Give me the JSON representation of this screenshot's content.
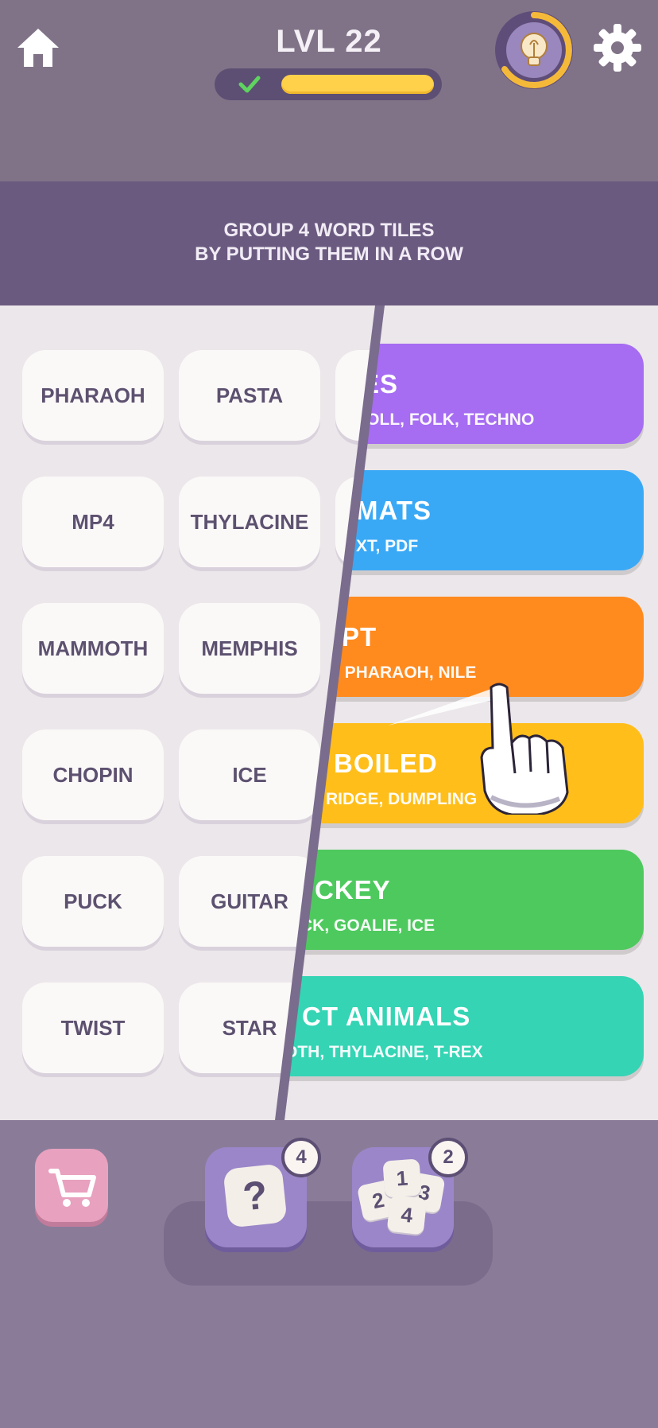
{
  "header": {
    "level_label": "LVL 22",
    "progress": 0.92
  },
  "instructions": {
    "line1": "GROUP 4 WORD TILES",
    "line2": "BY PUTTING THEM IN A ROW"
  },
  "tiles": [
    [
      "PHARAOH",
      "PASTA"
    ],
    [
      "MP4",
      "THYLACINE"
    ],
    [
      "MAMMOTH",
      "MEMPHIS"
    ],
    [
      "CHOPIN",
      "ICE"
    ],
    [
      "PUCK",
      "GUITAR"
    ],
    [
      "TWIST",
      "STAR"
    ]
  ],
  "categories": [
    {
      "name": "IRES",
      "words": "N' ROLL, FOLK, TECHNO",
      "color": "#a66cf2"
    },
    {
      "name": "MATS",
      "words": "XT, PDF",
      "color": "#3aa9f5"
    },
    {
      "name": "PT",
      "words": "S, PHARAOH, NILE",
      "color": "#ff8a1e"
    },
    {
      "name": "BOILED",
      "words": "RIDGE, DUMPLING",
      "color": "#ffbe1a"
    },
    {
      "name": "CKEY",
      "words": "CK, GOALIE, ICE",
      "color": "#4ec95e"
    },
    {
      "name": "CT ANIMALS",
      "words": "OTH, THYLACINE, T-REX",
      "color": "#34d4b4"
    }
  ],
  "boosters": {
    "hint_count": "4",
    "shuffle_count": "2",
    "shuffle_numbers": [
      "1",
      "2",
      "3",
      "4"
    ],
    "hint_symbol": "?"
  },
  "icons": [
    "home-icon",
    "check-icon",
    "lightbulb-icon",
    "gear-icon",
    "cart-icon",
    "tutorial-hand-icon"
  ]
}
